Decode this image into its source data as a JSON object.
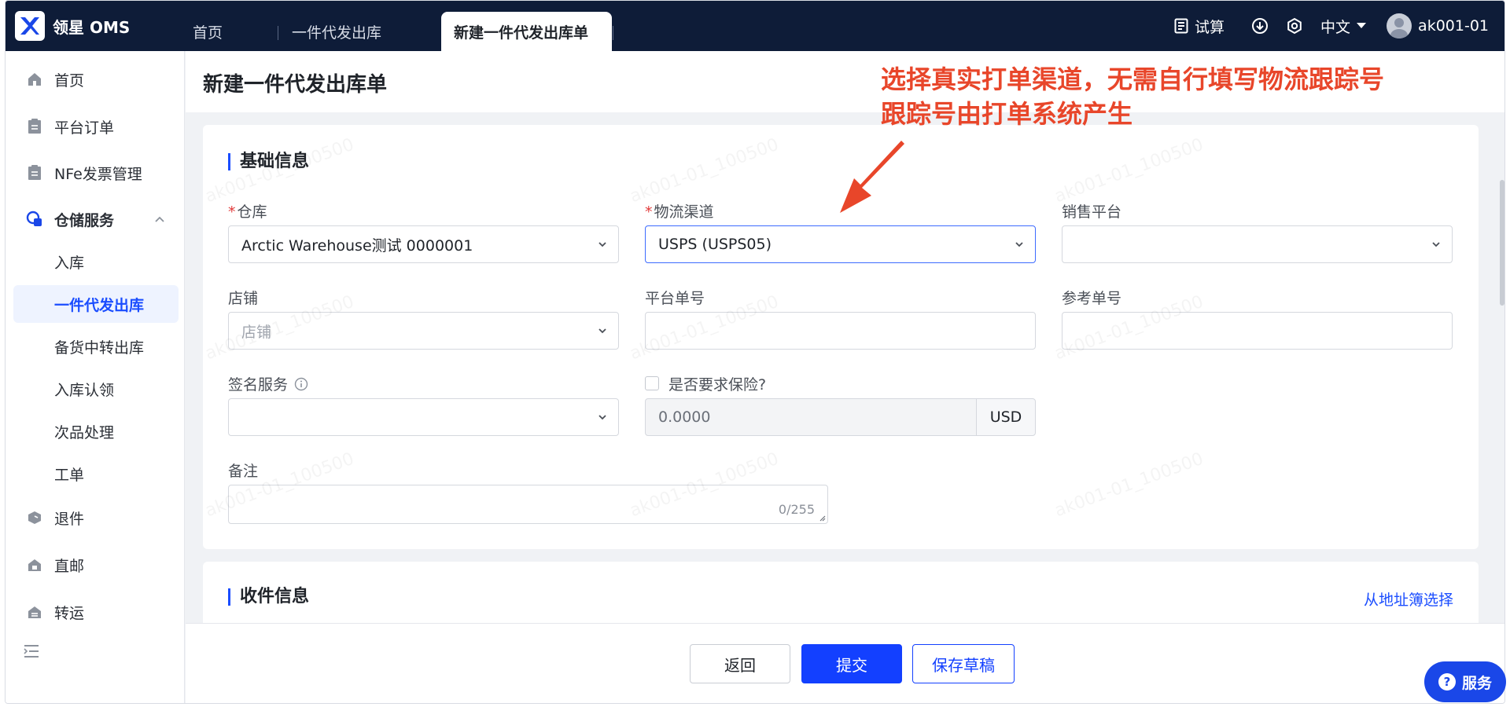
{
  "app": {
    "name": "领星 OMS"
  },
  "tabs": [
    "首页",
    "一件代发出库",
    "新建一件代发出库单"
  ],
  "header": {
    "calc": "试算",
    "lang": "中文",
    "user": "ak001-01"
  },
  "sidebar": {
    "items": [
      {
        "label": "首页",
        "icon": "home-icon"
      },
      {
        "label": "平台订单",
        "icon": "clipboard-icon"
      },
      {
        "label": "NFe发票管理",
        "icon": "clipboard-icon"
      },
      {
        "label": "仓储服务",
        "icon": "warehouse-icon"
      }
    ],
    "sub_items": [
      "入库",
      "一件代发出库",
      "备货中转出库",
      "入库认领",
      "次品处理",
      "工单"
    ],
    "bottom_items": [
      {
        "label": "退件",
        "icon": "return-icon"
      },
      {
        "label": "直邮",
        "icon": "mail-icon"
      },
      {
        "label": "转运",
        "icon": "transfer-icon"
      }
    ]
  },
  "page": {
    "title": "新建一件代发出库单",
    "annotation_line1": "选择真实打单渠道，无需自行填写物流跟踪号",
    "annotation_line2": "跟踪号由打单系统产生"
  },
  "basic": {
    "title": "基础信息",
    "warehouse_label": "仓库",
    "warehouse_value": "Arctic Warehouse测试 0000001",
    "channel_label": "物流渠道",
    "channel_value": "USPS (USPS05)",
    "platform_label": "销售平台",
    "shop_label": "店铺",
    "shop_placeholder": "店铺",
    "platform_no_label": "平台单号",
    "ref_no_label": "参考单号",
    "signature_label": "签名服务",
    "insurance_label": "是否要求保险?",
    "insurance_amount": "0.0000",
    "currency": "USD",
    "remark_label": "备注",
    "remark_counter": "0/255"
  },
  "receiver": {
    "title": "收件信息",
    "address_book_link": "从地址簿选择"
  },
  "footer": {
    "back": "返回",
    "submit": "提交",
    "save_draft": "保存草稿"
  },
  "service_button": "服务",
  "watermark": "ak001-01_100500",
  "colors": {
    "accent": "#1340ff",
    "topbar": "#0e1c38",
    "annotation": "#e8462a"
  }
}
